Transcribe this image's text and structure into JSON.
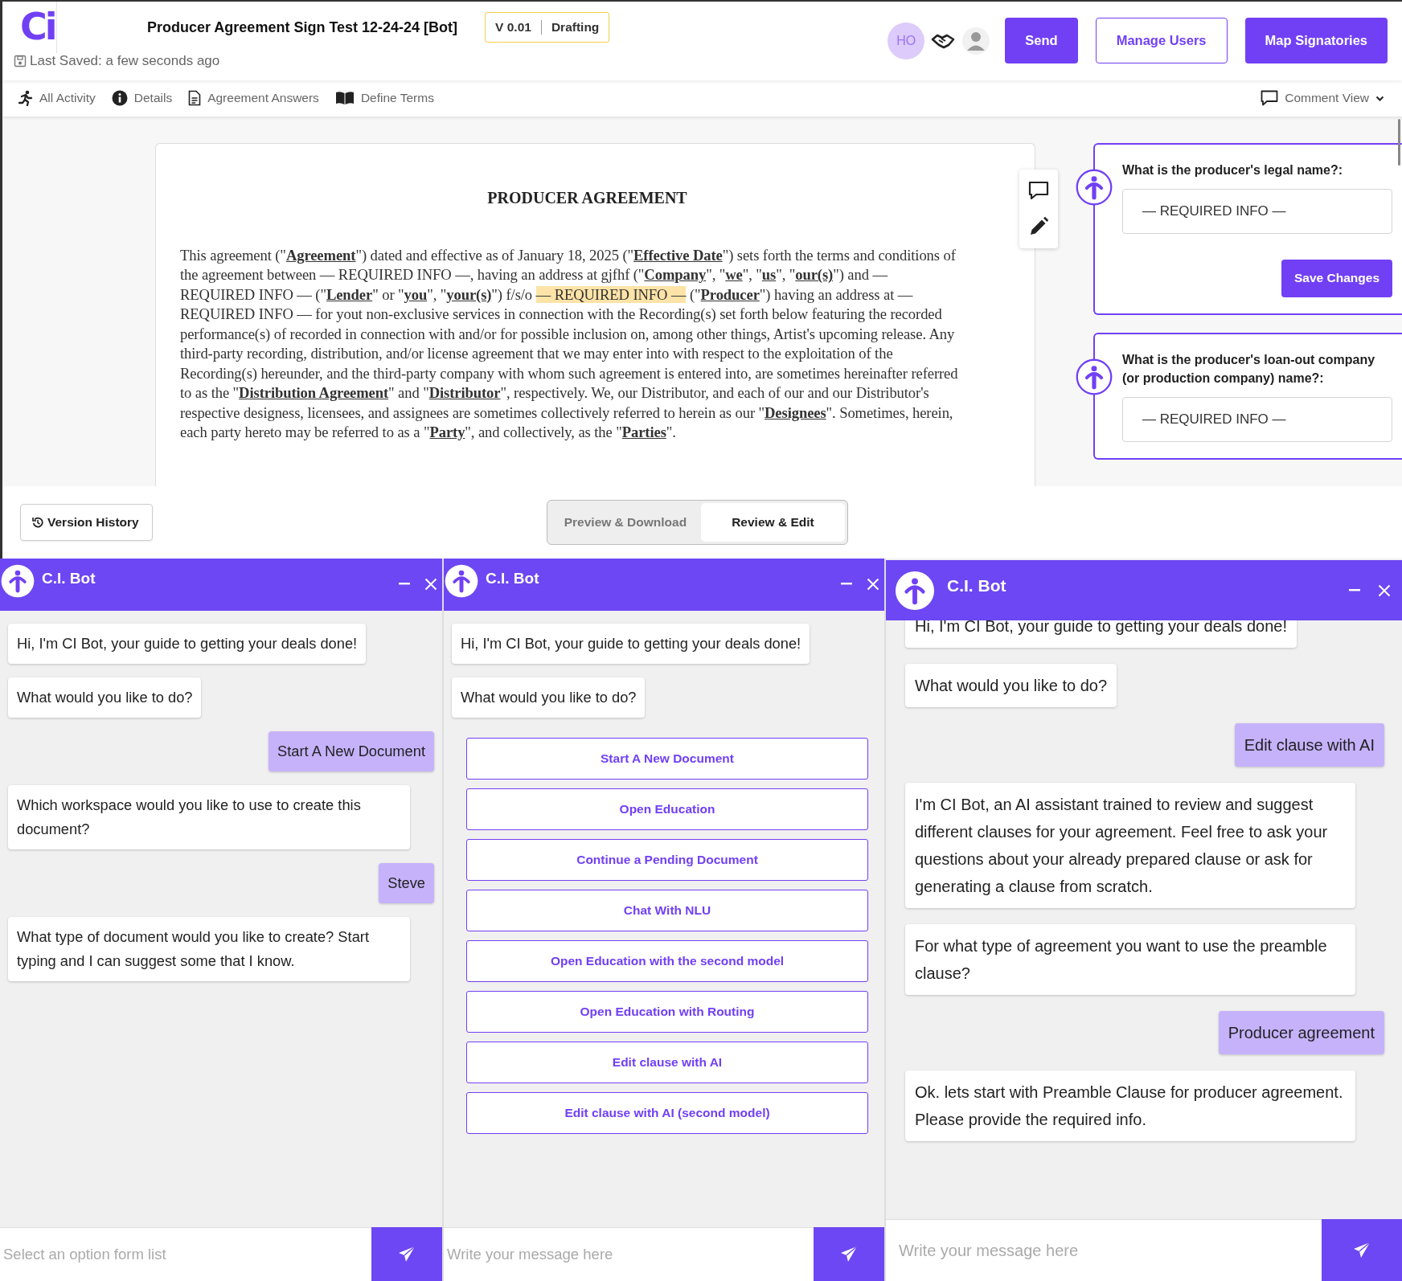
{
  "header": {
    "logo": "Ci",
    "title": "Producer Agreement Sign Test 12-24-24 [Bot]",
    "last_saved": "Last Saved: a few seconds ago",
    "version": "V 0.01",
    "status": "Drafting",
    "avatar_initials": "HO",
    "buttons": [
      {
        "label": "Send",
        "kind": "primary"
      },
      {
        "label": "Manage Users",
        "kind": "outline"
      },
      {
        "label": "Map Signatories",
        "kind": "primary"
      }
    ]
  },
  "nav": {
    "items": [
      {
        "label": "All Activity"
      },
      {
        "label": "Details"
      },
      {
        "label": "Agreement Answers"
      },
      {
        "label": "Define Terms"
      }
    ],
    "comment_view": "Comment View"
  },
  "document": {
    "title": "PRODUCER AGREEMENT",
    "paragraph": [
      {
        "text": "This agreement (\"**Agreement**\") dated and effective as of January 18, 2025 (\"**Effective Date**\") sets forth the terms and conditions of the agreement between — REQUIRED INFO —, having an address at gjfhf (\"**Company**\", \"**we**\", \"**us**\", \"**our(s)**\") and — REQUIRED INFO — (\"**Lender**\" or \"**you**\", \"**your(s)**\") f/s/o ",
        "highlighted": false
      },
      {
        "text": "— REQUIRED INFO —",
        "highlighted": true
      },
      {
        "text": " (\"**Producer**\") having an address at — REQUIRED INFO — for yout non-exclusive services in connection with the Recording(s) set forth below featuring the recorded performance(s) of recorded in connection with and/or for possible inclusion on, among other things, Artist's upcoming release. Any third-party recording, distribution, and/or license agreement that we may enter into with respect to the exploitation of the Recording(s) hereunder, and the third-party company with whom such agreement is entered into, are sometimes hereinafter referred to as the \"**Distribution Agreement**\" and \"**Distributor**\", respectively. We, our Distributor, and each of our and our Distributor's respective designess, licensees, and assignees are sometimes collectively referred to herein as our \"**Designees**\". Sometimes, herein, each party hereto may be referred to as a \"**Party**\", and collectively, as the \"**Parties**\".",
        "highlighted": false
      }
    ]
  },
  "questions": [
    {
      "label": "What is the producer's legal name?:",
      "value": "— REQUIRED INFO —",
      "button": "Save Changes"
    },
    {
      "label": "What is the producer's loan-out company (or production company) name?:",
      "value": "— REQUIRED INFO —"
    }
  ],
  "version_history": "Version History",
  "view_toggle": [
    {
      "label": "Preview & Download",
      "selected": false
    },
    {
      "label": "Review & Edit",
      "selected": true
    }
  ],
  "chats": [
    {
      "title": "C.I. Bot",
      "messages": [
        {
          "kind": "bot",
          "text": "Hi, I'm CI Bot, your guide to getting your deals done!"
        },
        {
          "kind": "bot",
          "text": "What would you like to do?"
        },
        {
          "kind": "user",
          "text": "Start A New Document"
        },
        {
          "kind": "bot",
          "text": "Which workspace would you like to use to create this document?"
        },
        {
          "kind": "user",
          "text": "Steve"
        },
        {
          "kind": "bot",
          "text": "What type of document would you like to create? Start typing and I can suggest some that I know."
        }
      ],
      "input": {
        "placeholder": "Select an option form list"
      }
    },
    {
      "title": "C.I. Bot",
      "messages": [
        {
          "kind": "bot",
          "text": "Hi, I'm CI Bot, your guide to getting your deals done!"
        },
        {
          "kind": "bot",
          "text": "What would you like to do?"
        },
        {
          "kind": "option",
          "text": "Start A New Document"
        },
        {
          "kind": "option",
          "text": "Open Education"
        },
        {
          "kind": "option",
          "text": "Continue a Pending Document"
        },
        {
          "kind": "option",
          "text": "Chat With NLU"
        },
        {
          "kind": "option",
          "text": "Open Education with the second model"
        },
        {
          "kind": "option",
          "text": "Open Education with Routing"
        },
        {
          "kind": "option",
          "text": "Edit clause with AI"
        },
        {
          "kind": "option",
          "text": "Edit clause with AI (second model)"
        }
      ],
      "input": {
        "placeholder": "Write your message here"
      }
    },
    {
      "title": "C.I. Bot",
      "messages": [
        {
          "kind": "bot",
          "text": "Hi, I'm CI Bot, your guide to getting your deals done!"
        },
        {
          "kind": "bot",
          "text": "What would you like to do?"
        },
        {
          "kind": "user",
          "text": "Edit clause with AI"
        },
        {
          "kind": "bot",
          "text": "I'm CI Bot, an AI assistant trained to review and suggest different clauses for your agreement. Feel free to ask your questions about your already prepared clause or ask for generating a clause from scratch."
        },
        {
          "kind": "bot",
          "text": "For what type of agreement you want to use the preamble clause?"
        },
        {
          "kind": "user",
          "text": "Producer agreement"
        },
        {
          "kind": "bot",
          "text": "Ok. lets start with Preamble Clause for producer agreement. Please provide the required info."
        }
      ],
      "input": {
        "placeholder": "Write your message here"
      }
    }
  ]
}
